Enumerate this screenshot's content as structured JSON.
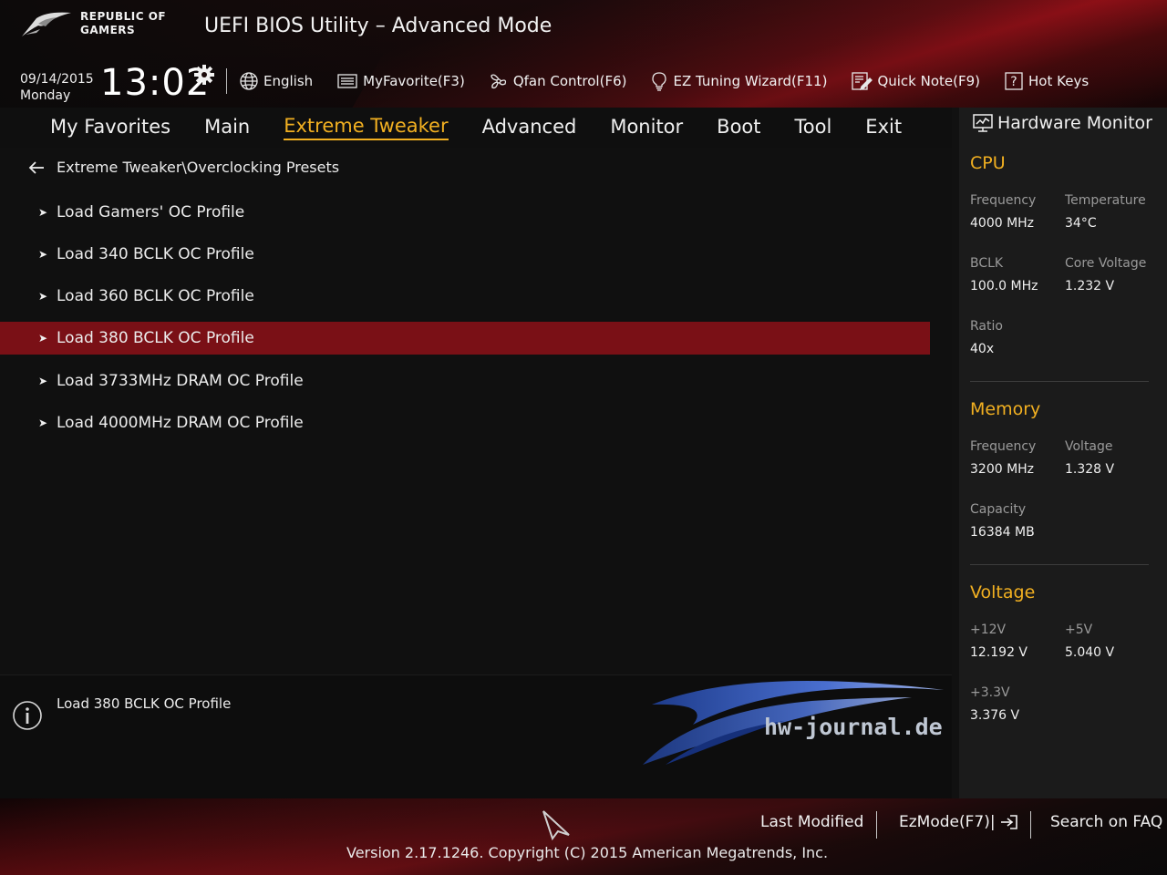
{
  "header": {
    "logo_line1": "REPUBLIC OF",
    "logo_line2": "GAMERS",
    "title": "UEFI BIOS Utility – Advanced Mode",
    "date": "09/14/2015",
    "day": "Monday",
    "time": "13:02"
  },
  "toolbar": {
    "language": "English",
    "myfavorite": "MyFavorite(F3)",
    "qfan": "Qfan Control(F6)",
    "ez_tuning": "EZ Tuning Wizard(F11)",
    "quick_note": "Quick Note(F9)",
    "hot_keys": "Hot Keys"
  },
  "tabs": [
    {
      "label": "My Favorites"
    },
    {
      "label": "Main"
    },
    {
      "label": "Extreme Tweaker",
      "active": true
    },
    {
      "label": "Advanced"
    },
    {
      "label": "Monitor"
    },
    {
      "label": "Boot"
    },
    {
      "label": "Tool"
    },
    {
      "label": "Exit"
    }
  ],
  "breadcrumb": "Extreme Tweaker\\Overclocking Presets",
  "items": [
    {
      "label": "Load Gamers' OC Profile"
    },
    {
      "label": "Load 340 BCLK OC Profile"
    },
    {
      "label": "Load 360 BCLK OC Profile"
    },
    {
      "label": "Load 380 BCLK OC Profile",
      "selected": true
    },
    {
      "label": "Load 3733MHz DRAM OC Profile"
    },
    {
      "label": "Load 4000MHz DRAM OC Profile"
    }
  ],
  "info": {
    "text": "Load 380 BCLK OC Profile",
    "watermark": "hw-journal.de"
  },
  "hwmon": {
    "title": "Hardware Monitor",
    "cpu": {
      "title": "CPU",
      "frequency_label": "Frequency",
      "frequency": "4000 MHz",
      "temperature_label": "Temperature",
      "temperature": "34°C",
      "bclk_label": "BCLK",
      "bclk": "100.0 MHz",
      "core_voltage_label": "Core Voltage",
      "core_voltage": "1.232 V",
      "ratio_label": "Ratio",
      "ratio": "40x"
    },
    "memory": {
      "title": "Memory",
      "frequency_label": "Frequency",
      "frequency": "3200 MHz",
      "voltage_label": "Voltage",
      "voltage": "1.328 V",
      "capacity_label": "Capacity",
      "capacity": "16384 MB"
    },
    "voltage": {
      "title": "Voltage",
      "v12_label": "+12V",
      "v12": "12.192 V",
      "v5_label": "+5V",
      "v5": "5.040 V",
      "v33_label": "+3.3V",
      "v33": "3.376 V"
    }
  },
  "footer": {
    "last_modified": "Last Modified",
    "ezmode": "EzMode(F7)|",
    "search_faq": "Search on FAQ",
    "version": "Version 2.17.1246. Copyright (C) 2015 American Megatrends, Inc."
  },
  "colors": {
    "accent": "#f2b021",
    "selected_row": "#7a1016",
    "brand_red": "#c2121c"
  }
}
